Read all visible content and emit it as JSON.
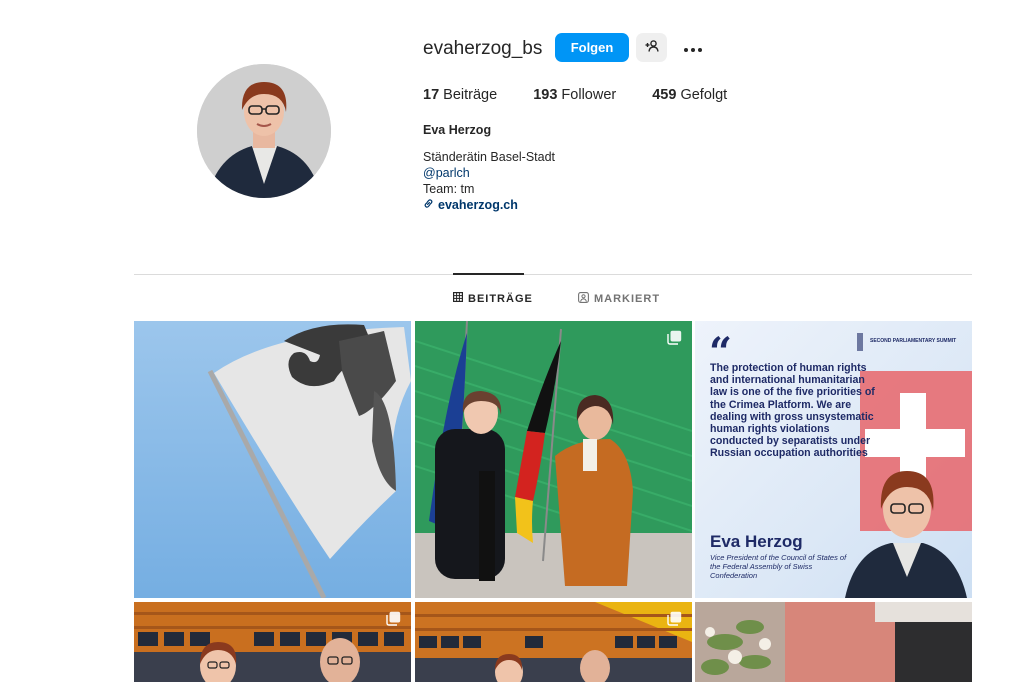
{
  "profile": {
    "username": "evaherzog_bs",
    "follow_label": "Folgen",
    "stats": {
      "posts_count": "17",
      "posts_label": "Beiträge",
      "followers_count": "193",
      "followers_label": "Follower",
      "following_count": "459",
      "following_label": "Gefolgt"
    },
    "bio": {
      "name": "Eva Herzog",
      "line1": "Ständerätin Basel-Stadt",
      "mention": "@parlch",
      "line3": "Team: tm",
      "link": "evaherzog.ch"
    }
  },
  "tabs": [
    {
      "label": "BEITRÄGE",
      "active": true,
      "icon": "grid-icon"
    },
    {
      "label": "MARKIERT",
      "active": false,
      "icon": "tagged-icon"
    }
  ],
  "posts": {
    "post3": {
      "quote": "The protection of human rights and international humanitarian law is one of the five priorities of the Crimea Platform. We are dealing with gross unsystematic human rights violations conducted by separatists under Russian occupation authorities",
      "summit": "SECOND PARLIAMENTARY SUMMIT",
      "name": "Eva Herzog",
      "role": "Vice President of the Council of States of the Federal Assembly of Swiss Confederation"
    }
  },
  "colors": {
    "accent": "#0095f6",
    "text": "#262626",
    "link": "#00376b",
    "muted": "#737373",
    "border": "#dbdbdb"
  }
}
